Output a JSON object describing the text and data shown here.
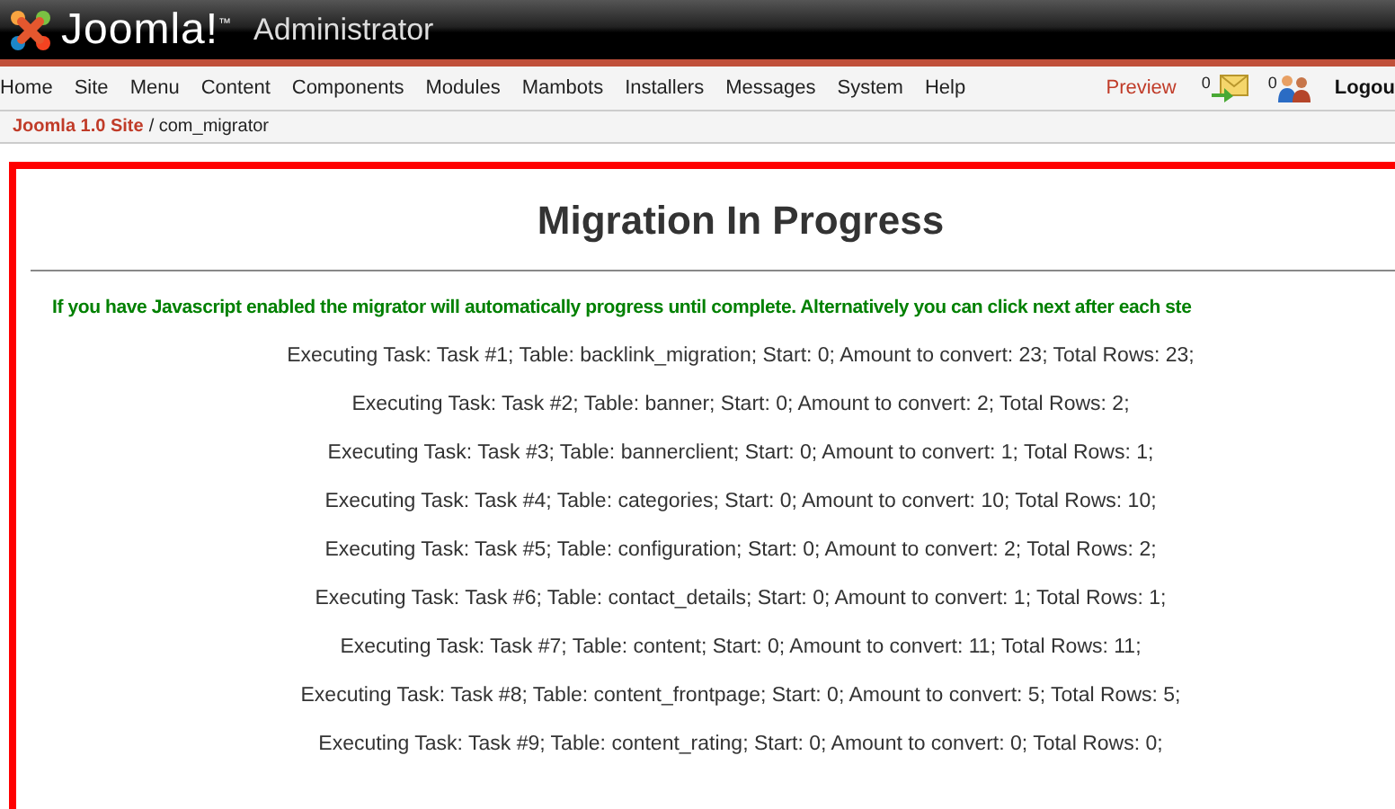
{
  "header": {
    "logo_text": "Joomla!$^{™}$",
    "subtitle": "Administrator"
  },
  "menu": {
    "items": [
      "Home",
      "Site",
      "Menu",
      "Content",
      "Components",
      "Modules",
      "Mambots",
      "Installers",
      "Messages",
      "System",
      "Help"
    ],
    "preview": "Preview",
    "messages_count": "0",
    "users_count": "0",
    "logout": "Logou"
  },
  "breadcrumb": {
    "site": "Joomla 1.0 Site",
    "path": "/ com_migrator"
  },
  "panel": {
    "title": "Migration In Progress",
    "notice": "If you have Javascript enabled the migrator will automatically progress until complete. Alternatively you can click next after each ste",
    "tasks": [
      "Executing Task: Task #1; Table: backlink_migration; Start: 0; Amount to convert: 23; Total Rows: 23;",
      "Executing Task: Task #2; Table: banner; Start: 0; Amount to convert: 2; Total Rows: 2;",
      "Executing Task: Task #3; Table: bannerclient; Start: 0; Amount to convert: 1; Total Rows: 1;",
      "Executing Task: Task #4; Table: categories; Start: 0; Amount to convert: 10; Total Rows: 10;",
      "Executing Task: Task #5; Table: configuration; Start: 0; Amount to convert: 2; Total Rows: 2;",
      "Executing Task: Task #6; Table: contact_details; Start: 0; Amount to convert: 1; Total Rows: 1;",
      "Executing Task: Task #7; Table: content; Start: 0; Amount to convert: 11; Total Rows: 11;",
      "Executing Task: Task #8; Table: content_frontpage; Start: 0; Amount to convert: 5; Total Rows: 5;",
      "Executing Task: Task #9; Table: content_rating; Start: 0; Amount to convert: 0; Total Rows: 0;"
    ]
  }
}
